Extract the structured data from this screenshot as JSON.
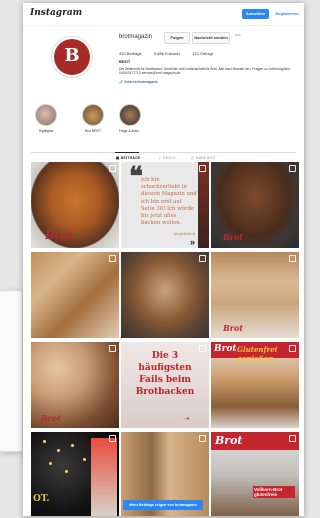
{
  "topbar": {
    "logo": "Instagram",
    "login": "Anmelden",
    "register": "Registrieren"
  },
  "profile": {
    "avatar_letter": "B",
    "username": "brotmagazin",
    "follow": "Folgen",
    "message": "Nachricht senden",
    "more": "···",
    "stats": {
      "posts": "453 Beiträge",
      "followers": "9.686 Follower",
      "following": "210 Gefolgt"
    },
    "name": "BROT",
    "bio": "Die Zeitschrift für Brotbacker, Genießer und Leidenschaft für Brot. Alle zwei Monate neu. Fragen zu Lieferung/Abo: 040/42477713 service@brot-magazin.de",
    "link": "linktr.ee/brotmagazin"
  },
  "highlights": [
    {
      "label": "Highlights",
      "color": "#b79a8a"
    },
    {
      "label": "Brot BROT",
      "color": "#9c7a52"
    },
    {
      "label": "Frage & Antw...",
      "color": "#6a5446"
    }
  ],
  "tabs": [
    {
      "label": "BEITRÄGE",
      "active": true
    },
    {
      "label": "REELS",
      "active": false
    },
    {
      "label": "MARKIERT",
      "active": false
    }
  ],
  "posts": {
    "p1_brand": "Brot",
    "p2_quote": "Ich bin schockverliebt in diesem Magazin und ich bin erst auf Seite 30! Ich würde bis jetzt alles backen wollen.",
    "p2_sign": "lenpetitbrot",
    "p3_brand": "Brot",
    "p6_brand": "Brot",
    "p7_brand": "Brot",
    "p8_title": "Die 3 häufigsten Fails beim Brotbacken",
    "p9_brand": "Brot",
    "p9_title": "Glutenfrei genießen",
    "p10_brand": "OT.",
    "p12_brand": "Brot",
    "p12_text": "Vollkorn-Brot glutenfreie"
  },
  "show_more": "Mehr Beiträge zeigen von brotmagazin",
  "colors": {
    "accent": "#2a87f3",
    "brand_red": "#a72c27"
  }
}
